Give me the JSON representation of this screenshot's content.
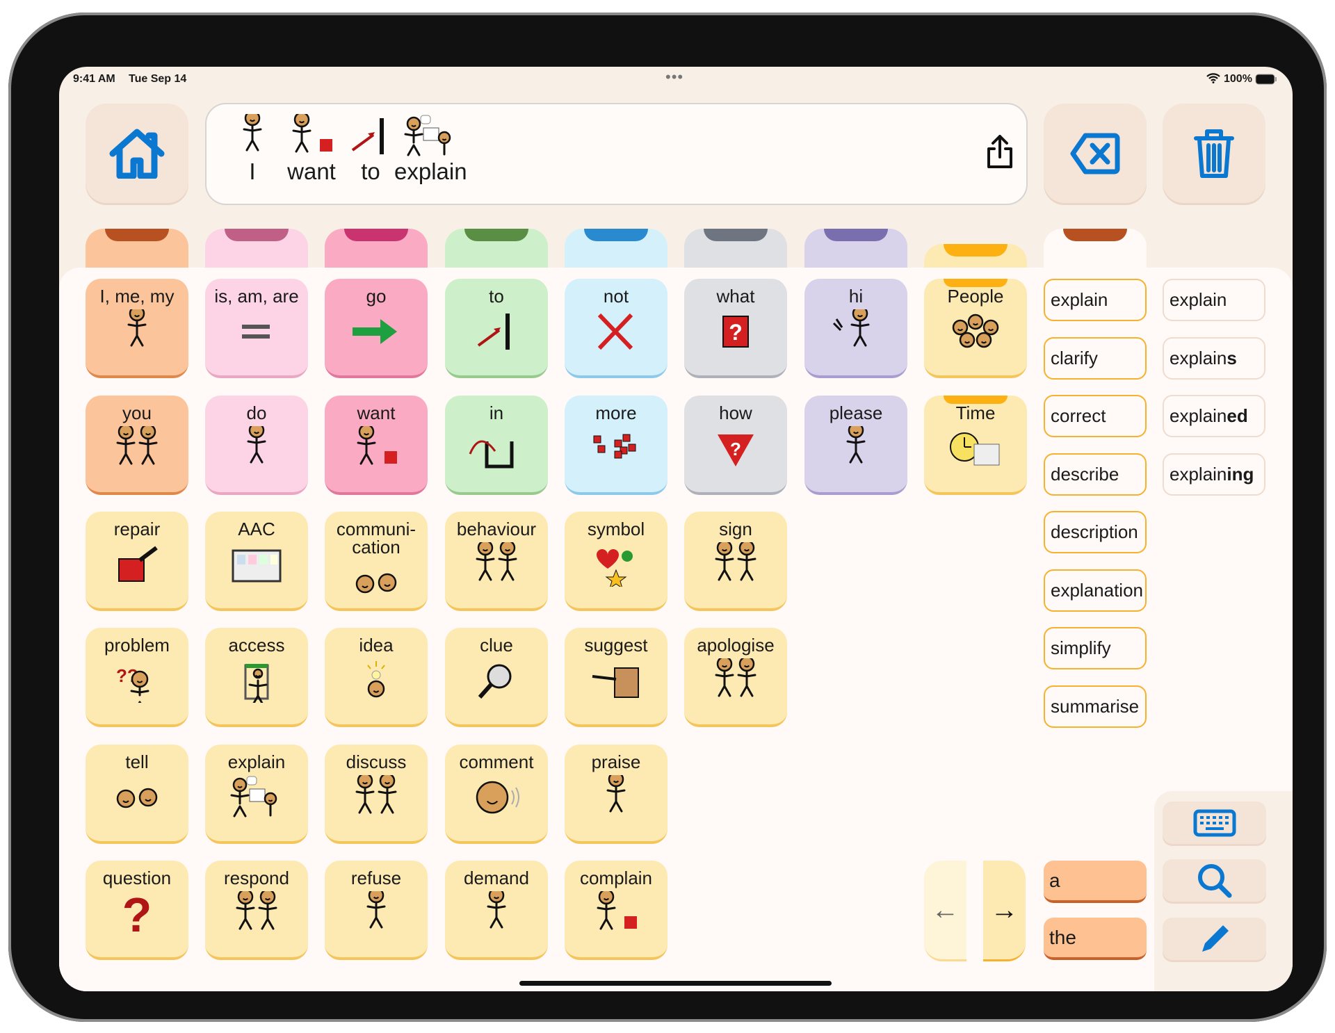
{
  "status_bar": {
    "time": "9:41 AM",
    "date": "Tue Sep 14",
    "battery": "100%",
    "multitask": "•••"
  },
  "toolbar": {
    "home_icon": "home-icon",
    "share_icon": "share-icon",
    "backspace_icon": "backspace-icon",
    "clear_icon": "trash-icon"
  },
  "sentence": [
    {
      "label": "I",
      "icon": "person-point"
    },
    {
      "label": "want",
      "icon": "want"
    },
    {
      "label": "to",
      "icon": "to"
    },
    {
      "label": "explain",
      "icon": "explain"
    }
  ],
  "colors": {
    "orange": {
      "bg": "#fcc49a",
      "tab": "#b85122",
      "edge": "#e0874a"
    },
    "lightpink": {
      "bg": "#fdd4e6",
      "tab": "#c06086",
      "edge": "#e9a7c3"
    },
    "pink": {
      "bg": "#fbaac4",
      "tab": "#c93470",
      "edge": "#e2779d"
    },
    "green": {
      "bg": "#cdefc9",
      "tab": "#5a8e45",
      "edge": "#98c98d"
    },
    "blue": {
      "bg": "#d4f0fb",
      "tab": "#2a8ad0",
      "edge": "#8cc9ea"
    },
    "gray": {
      "bg": "#dfe0e3",
      "tab": "#6e7480",
      "edge": "#aeb1b8"
    },
    "purple": {
      "bg": "#d8d2ea",
      "tab": "#7a6fae",
      "edge": "#a99cd0"
    },
    "yellow": {
      "bg": "#fdeab2",
      "tab": "#fdb012",
      "edge": "#f3c55a"
    },
    "white": {
      "bg": "#fffaf8",
      "tab": "#b85122",
      "edge": "#eeddd0"
    },
    "accent": "#0a78d0"
  },
  "tabs": [
    "orange",
    "lightpink",
    "pink",
    "green",
    "blue",
    "gray",
    "purple",
    "yellow",
    "white"
  ],
  "grid": [
    [
      {
        "label": "I, me, my",
        "icon": "person-point",
        "color": "orange"
      },
      {
        "label": "is, am, are",
        "icon": "equals",
        "color": "lightpink"
      },
      {
        "label": "go",
        "icon": "arrow-right",
        "color": "pink"
      },
      {
        "label": "to",
        "icon": "to",
        "color": "green"
      },
      {
        "label": "not",
        "icon": "cross",
        "color": "blue"
      },
      {
        "label": "what",
        "icon": "question-box",
        "color": "gray"
      },
      {
        "label": "hi",
        "icon": "wave",
        "color": "purple"
      },
      {
        "label": "People",
        "icon": "people",
        "color": "yellow",
        "folder": true
      }
    ],
    [
      {
        "label": "you",
        "icon": "two-people",
        "color": "orange"
      },
      {
        "label": "do",
        "icon": "person",
        "color": "lightpink"
      },
      {
        "label": "want",
        "icon": "want",
        "color": "pink"
      },
      {
        "label": "in",
        "icon": "in",
        "color": "green"
      },
      {
        "label": "more",
        "icon": "more",
        "color": "blue"
      },
      {
        "label": "how",
        "icon": "question-triangle",
        "color": "gray"
      },
      {
        "label": "please",
        "icon": "person",
        "color": "purple"
      },
      {
        "label": "Time",
        "icon": "clock",
        "color": "yellow",
        "folder": true
      }
    ],
    [
      {
        "label": "repair",
        "icon": "repair",
        "color": "yellow"
      },
      {
        "label": "AAC",
        "icon": "aac-board",
        "color": "yellow"
      },
      {
        "label": "communi-\ncation",
        "icon": "two-faces",
        "color": "yellow"
      },
      {
        "label": "behaviour",
        "icon": "two-people",
        "color": "yellow"
      },
      {
        "label": "symbol",
        "icon": "symbol",
        "color": "yellow"
      },
      {
        "label": "sign",
        "icon": "two-people",
        "color": "yellow"
      }
    ],
    [
      {
        "label": "problem",
        "icon": "problem",
        "color": "yellow"
      },
      {
        "label": "access",
        "icon": "door",
        "color": "yellow"
      },
      {
        "label": "idea",
        "icon": "idea",
        "color": "yellow"
      },
      {
        "label": "clue",
        "icon": "magnifier",
        "color": "yellow"
      },
      {
        "label": "suggest",
        "icon": "box",
        "color": "yellow"
      },
      {
        "label": "apologise",
        "icon": "two-people",
        "color": "yellow"
      }
    ],
    [
      {
        "label": "tell",
        "icon": "two-faces",
        "color": "yellow"
      },
      {
        "label": "explain",
        "icon": "explain",
        "color": "yellow"
      },
      {
        "label": "discuss",
        "icon": "two-people",
        "color": "yellow"
      },
      {
        "label": "comment",
        "icon": "face",
        "color": "yellow"
      },
      {
        "label": "praise",
        "icon": "person",
        "color": "yellow"
      }
    ],
    [
      {
        "label": "question",
        "icon": "question-big",
        "color": "yellow"
      },
      {
        "label": "respond",
        "icon": "two-people",
        "color": "yellow"
      },
      {
        "label": "refuse",
        "icon": "person",
        "color": "yellow"
      },
      {
        "label": "demand",
        "icon": "person",
        "color": "yellow"
      },
      {
        "label": "complain",
        "icon": "want",
        "color": "yellow"
      }
    ]
  ],
  "related_words": [
    "explain",
    "clarify",
    "correct",
    "describe",
    "description",
    "explanation",
    "simplify",
    "summarise"
  ],
  "word_forms": [
    {
      "base": "explain",
      "suffix": ""
    },
    {
      "base": "explain",
      "suffix": "s"
    },
    {
      "base": "explain",
      "suffix": "ed"
    },
    {
      "base": "explain",
      "suffix": "ing"
    }
  ],
  "articles": [
    "a",
    "the"
  ],
  "paging": {
    "prev": "←",
    "next": "→"
  },
  "side_tools": [
    "keyboard-icon",
    "search-icon",
    "pencil-icon"
  ]
}
